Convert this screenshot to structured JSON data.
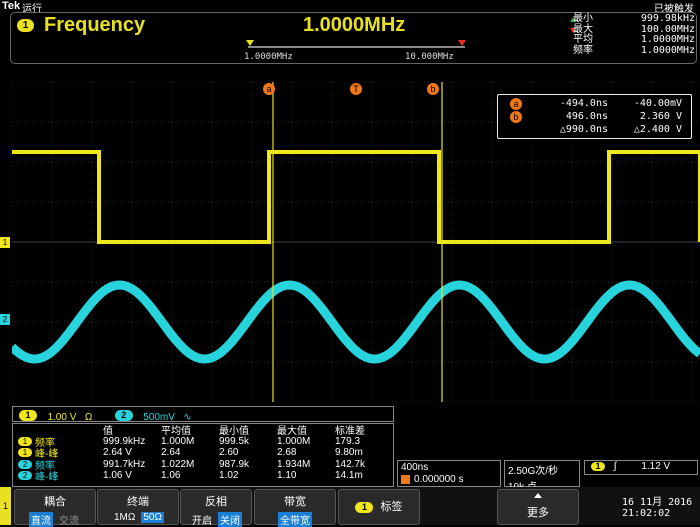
{
  "status": {
    "brand": "Tek",
    "run_state": "运行",
    "trigger_state": "已被触发"
  },
  "frequency_panel": {
    "badge": "1",
    "label": "Frequency",
    "value": "1.0000MHz",
    "range_min": "1.0000MHz",
    "range_max": "10.000MHz",
    "stats": [
      {
        "label": "最小",
        "value": "999.98kHz"
      },
      {
        "label": "最大",
        "value": "100.00MHz"
      },
      {
        "label": "平均",
        "value": "1.0000MHz"
      },
      {
        "label": "频率",
        "value": "1.0000MHz"
      }
    ]
  },
  "cursors": {
    "marker_a": "a",
    "marker_b": "b",
    "marker_t": "T",
    "rows": [
      {
        "badge": "a",
        "time": "-494.0ns",
        "value": "-40.00mV"
      },
      {
        "badge": "b",
        "time": "496.0ns",
        "value": "2.360 V"
      },
      {
        "badge": "",
        "time": "△990.0ns",
        "value": "△2.400 V"
      }
    ]
  },
  "channels": {
    "ch1": {
      "badge": "1",
      "scale": "1.00 V",
      "unit": "Ω",
      "color": "#f0e61c"
    },
    "ch2": {
      "badge": "2",
      "scale": "500mV",
      "unit": "∿",
      "color": "#28d4dc"
    }
  },
  "left_markers": {
    "ch1": "1",
    "ch2": "2"
  },
  "measurements": {
    "headers": [
      "值",
      "平均值",
      "最小值",
      "最大值",
      "标准差"
    ],
    "rows": [
      {
        "ch": "1",
        "name": "频率",
        "values": [
          "999.9kHz",
          "1.000M",
          "999.5k",
          "1.000M",
          "179.3"
        ]
      },
      {
        "ch": "1",
        "name": "峰-峰",
        "values": [
          "2.64 V",
          "2.64",
          "2.60",
          "2.68",
          "9.80m"
        ]
      },
      {
        "ch": "2",
        "name": "频率",
        "values": [
          "991.7kHz",
          "1.022M",
          "987.9k",
          "1.934M",
          "142.7k"
        ]
      },
      {
        "ch": "2",
        "name": "峰-峰",
        "values": [
          "1.06 V",
          "1.06",
          "1.02",
          "1.10",
          "14.1m"
        ]
      }
    ]
  },
  "horizontal": {
    "timebase": "400ns",
    "position": "0.000000 s",
    "sample_rate": "2.50G次/秒",
    "record_length": "10k 点"
  },
  "trigger": {
    "source": "1",
    "slope": "∫",
    "level": "1.12 V"
  },
  "menu": {
    "side": "1",
    "coupling": {
      "label": "耦合",
      "options": [
        "直流",
        "交流"
      ],
      "selected": 0
    },
    "termination": {
      "label": "终端",
      "options": [
        "1MΩ",
        "50Ω"
      ],
      "selected": 1
    },
    "invert": {
      "label": "反相",
      "options": [
        "开启",
        "关闭"
      ],
      "selected": 1
    },
    "bandwidth": {
      "label": "带宽",
      "value": "全带宽"
    },
    "tag": {
      "badge": "1",
      "label": "标签"
    },
    "more": {
      "label": "更多"
    }
  },
  "datetime": {
    "date": "16 11月 2016",
    "time": "21:02:02"
  },
  "waveforms": {
    "ch1_high_div": 2.1,
    "ch1_low_div": 0.2,
    "ch2_amplitude_div": 0.9,
    "ch2_period_ns": 1008
  }
}
